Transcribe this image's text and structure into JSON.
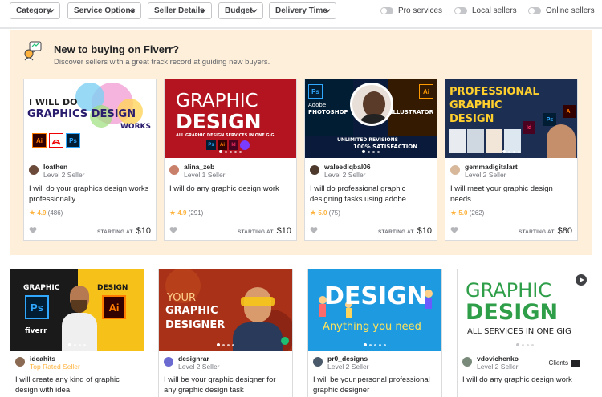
{
  "filters": {
    "category": "Category",
    "service_options": "Service Options",
    "seller_details": "Seller Details",
    "budget": "Budget",
    "delivery_time": "Delivery Time"
  },
  "toggles": {
    "pro": "Pro services",
    "local": "Local sellers",
    "online": "Online sellers"
  },
  "promo": {
    "title": "New to buying on Fiverr?",
    "subtitle": "Discover sellers with a great track record at guiding new buyers."
  },
  "starting_at_label": "STARTING AT",
  "promo_cards": [
    {
      "seller": "loathen",
      "level": "Level 2 Seller",
      "title": "I will do your graphics design works professionally",
      "rating": "4.9",
      "reviews": "(486)",
      "price": "$10",
      "thumb": {
        "line1": "I WILL DO",
        "line2": "GRAPHICS DESIGN",
        "line3": "WORKS",
        "badges": [
          "Ai",
          "Ps"
        ]
      }
    },
    {
      "seller": "alina_zeb",
      "level": "Level 1 Seller",
      "title": "I will do any graphic design work",
      "rating": "4.9",
      "reviews": "(291)",
      "price": "$10",
      "thumb": {
        "line1": "GRAPHIC",
        "line2": "DESIGN",
        "line3": "ALL GRAPHIC DESIGN SERVICES IN ONE GIG",
        "badges": [
          "Ps",
          "Ai",
          "Id"
        ]
      }
    },
    {
      "seller": "waleediqbal06",
      "level": "Level 2 Seller",
      "title": "I will do professional graphic designing tasks using adobe...",
      "rating": "5.0",
      "reviews": "(75)",
      "price": "$10",
      "thumb": {
        "line1": "Adobe",
        "line2": "PHOTOSHOP",
        "line3": "ILLUSTRATOR",
        "line4": "100% SATISFACTION",
        "line5": "UNLIMITED REVISIONS",
        "badges": [
          "Ps",
          "Ai"
        ]
      }
    },
    {
      "seller": "gemmadigitalart",
      "level": "Level 2 Seller",
      "title": "I will meet your graphic design needs",
      "rating": "5.0",
      "reviews": "(262)",
      "price": "$80",
      "thumb": {
        "line1": "PROFESSIONAL",
        "line2": "GRAPHIC",
        "line3": "DESIGN",
        "badges": [
          "Ai",
          "Ps",
          "Id"
        ]
      }
    }
  ],
  "cards": [
    {
      "seller": "ideahits",
      "level": "Top Rated Seller",
      "title": "I will create any kind of graphic design with idea",
      "thumb": {
        "line1": "GRAPHIC",
        "line2": "DESIGN",
        "brand": "fiverr",
        "badges": [
          "Ps",
          "Ai"
        ]
      }
    },
    {
      "seller": "designrar",
      "level": "Level 2 Seller",
      "title": "I will be your graphic designer for any graphic design task",
      "thumb": {
        "line1": "YOUR",
        "line2": "GRAPHIC",
        "line3": "DESIGNER"
      }
    },
    {
      "seller": "pr0_designs",
      "level": "Level 2 Seller",
      "title": "I will be your personal professional graphic designer",
      "thumb": {
        "line1": "DESIGN",
        "line2": "Anything you need"
      }
    },
    {
      "seller": "vdovichenko",
      "level": "Level 2 Seller",
      "title": "I will do any graphic design work",
      "clients": "Clients",
      "thumb": {
        "line1": "GRAPHIC",
        "line2": "DESIGN",
        "line3": "ALL SERVICES IN ONE GIG"
      }
    }
  ],
  "colors": {
    "panel_bg": "#fdefda",
    "star": "#ffb33e",
    "top_rated": "#ffb33e",
    "border": "#dadbdd"
  }
}
